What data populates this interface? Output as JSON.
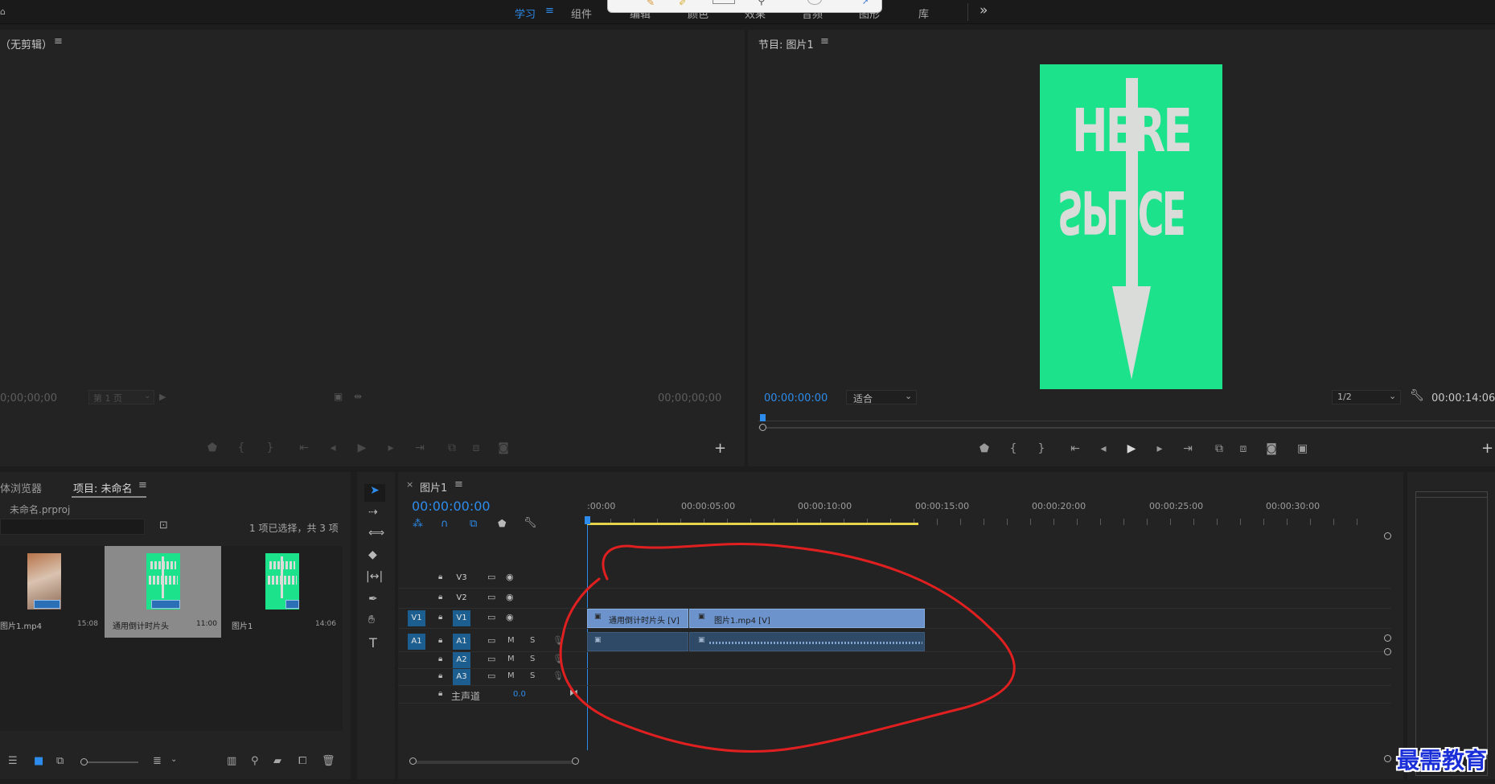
{
  "colors": {
    "accent": "#2d8ceb",
    "clip_video": "#6c93cc",
    "clip_audio": "#2f4a67",
    "poster_green": "#1ce28c",
    "annotation_red": "#e02020"
  },
  "workspace_tabs": [
    "学习",
    "组件",
    "编辑",
    "颜色",
    "效果",
    "音频",
    "图形",
    "库"
  ],
  "workspace_more": "»",
  "source": {
    "title": "（无剪辑）",
    "timecode_left": "0;00;00;00",
    "page": "第 1 页",
    "timecode_right": "00;00;00;00"
  },
  "program": {
    "title": "节目: 图片1",
    "timecode": "00:00:00:00",
    "fit": "适合",
    "resolution": "1/2",
    "duration": "00:00:14:06",
    "poster_text_top": "HERE",
    "poster_text_bottom": "SPLICE"
  },
  "project": {
    "tab_media_browser": "体浏览器",
    "tab_project": "项目: 未命名",
    "file_name": "未命名.prproj",
    "selection_info": "1 项已选择，共 3 项",
    "items": [
      {
        "name": "图片1.mp4",
        "duration": "15:08"
      },
      {
        "name": "通用倒计时片头",
        "duration": "11:00"
      },
      {
        "name": "图片1",
        "duration": "14:06"
      }
    ]
  },
  "timeline": {
    "tab": "图片1",
    "timecode": "00:00:00:00",
    "ruler": [
      ":00:00",
      "00:00:05:00",
      "00:00:10:00",
      "00:00:15:00",
      "00:00:20:00",
      "00:00:25:00",
      "00:00:30:00"
    ],
    "video_tracks": [
      "V3",
      "V2",
      "V1"
    ],
    "audio_tracks": [
      "A1",
      "A2",
      "A3"
    ],
    "source_v": "V1",
    "source_a": "A1",
    "mute": "M",
    "solo": "S",
    "master": "主声道",
    "master_value": "0.0",
    "clip_1": "通用倒计时片头 [V]",
    "clip_2": "图片1.mp4 [V]"
  },
  "watermark": "最需教育"
}
